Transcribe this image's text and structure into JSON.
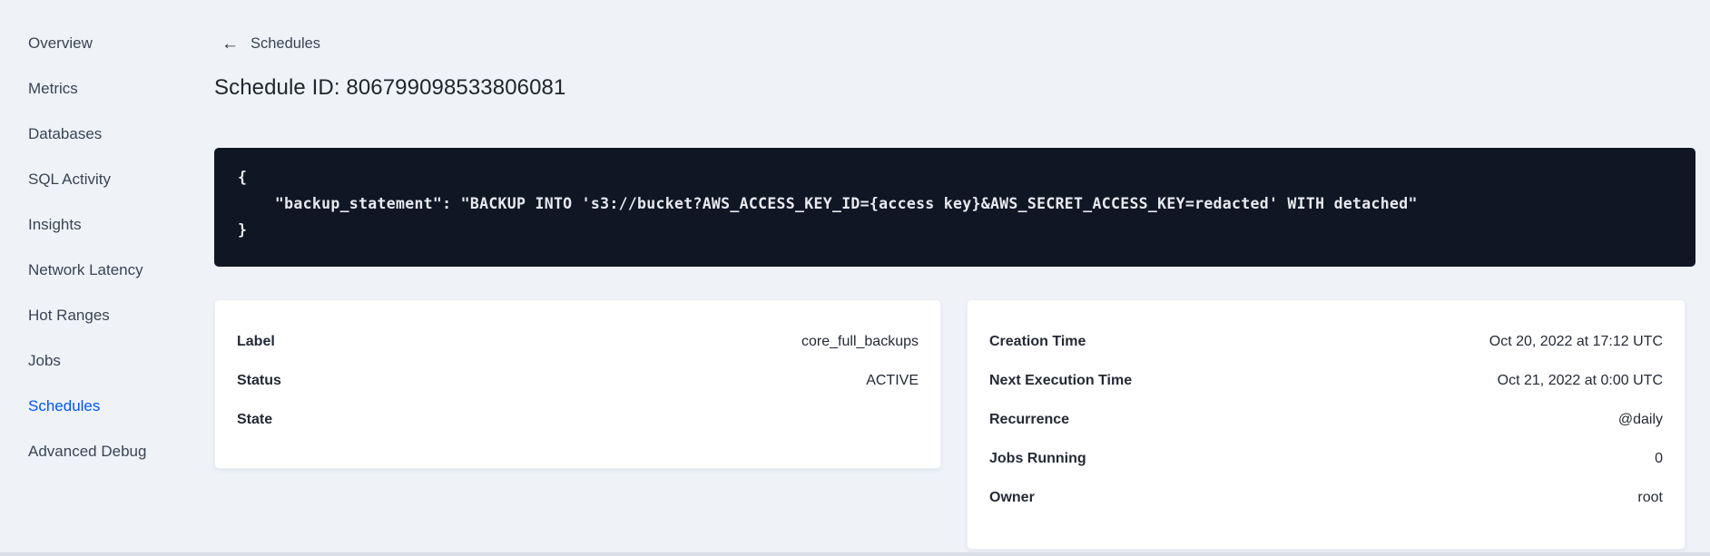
{
  "sidebar": {
    "items": [
      {
        "label": "Overview",
        "active": false
      },
      {
        "label": "Metrics",
        "active": false
      },
      {
        "label": "Databases",
        "active": false
      },
      {
        "label": "SQL Activity",
        "active": false
      },
      {
        "label": "Insights",
        "active": false
      },
      {
        "label": "Network Latency",
        "active": false
      },
      {
        "label": "Hot Ranges",
        "active": false
      },
      {
        "label": "Jobs",
        "active": false
      },
      {
        "label": "Schedules",
        "active": true
      },
      {
        "label": "Advanced Debug",
        "active": false
      }
    ]
  },
  "header": {
    "back_arrow": "←",
    "back_label": "Schedules",
    "title": "Schedule ID: 806799098533806081"
  },
  "code_block": {
    "content": "{\n    \"backup_statement\": \"BACKUP INTO 's3://bucket?AWS_ACCESS_KEY_ID={access key}&AWS_SECRET_ACCESS_KEY=redacted' WITH detached\"\n}"
  },
  "details_card": {
    "rows": [
      {
        "label": "Label",
        "value": "core_full_backups"
      },
      {
        "label": "Status",
        "value": "ACTIVE"
      },
      {
        "label": "State",
        "value": ""
      }
    ]
  },
  "schedule_card": {
    "rows": [
      {
        "label": "Creation Time",
        "value": "Oct 20, 2022 at 17:12 UTC"
      },
      {
        "label": "Next Execution Time",
        "value": "Oct 21, 2022 at 0:00 UTC"
      },
      {
        "label": "Recurrence",
        "value": "@daily"
      },
      {
        "label": "Jobs Running",
        "value": "0"
      },
      {
        "label": "Owner",
        "value": "root"
      }
    ]
  },
  "colors": {
    "accent_blue": "#0055ff",
    "page_bg": "#eff3f8",
    "code_bg": "#101724",
    "card_bg": "#ffffff"
  }
}
